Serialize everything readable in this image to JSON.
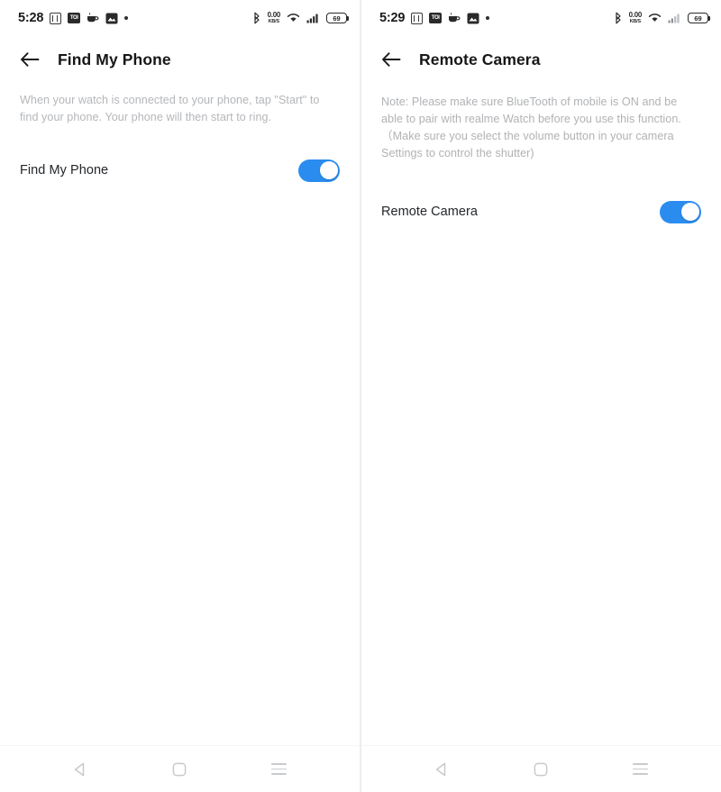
{
  "panels": [
    {
      "id": "find-my-phone",
      "statusbar": {
        "time": "5:28",
        "netspeed_value": "0.00",
        "netspeed_unit": "KB/S",
        "battery_level": "69",
        "icons_left": [
          "calendar-icon",
          "box-icon",
          "coffee-icon",
          "image-icon",
          "dot-icon"
        ],
        "icons_right": [
          "bluetooth-icon",
          "network-speed-icon",
          "wifi-icon",
          "signal-icon",
          "battery-icon"
        ],
        "notif_box_label": "TOI"
      },
      "appbar": {
        "back_label": "back-arrow",
        "title": "Find My Phone"
      },
      "description": "When your watch is connected to your phone, tap \"Start\" to find your phone. Your phone will then start to ring.",
      "setting": {
        "label": "Find My Phone",
        "toggle_on": true,
        "toggle_color": "#2b8cf0"
      },
      "navbar": {
        "back_label": "back",
        "home_label": "home",
        "recents_label": "recents"
      }
    },
    {
      "id": "remote-camera",
      "statusbar": {
        "time": "5:29",
        "netspeed_value": "0.00",
        "netspeed_unit": "KB/S",
        "battery_level": "69",
        "icons_left": [
          "calendar-icon",
          "box-icon",
          "coffee-icon",
          "image-icon",
          "dot-icon"
        ],
        "icons_right": [
          "bluetooth-icon",
          "network-speed-icon",
          "wifi-icon",
          "signal-icon",
          "battery-icon"
        ],
        "notif_box_label": "TOI"
      },
      "appbar": {
        "back_label": "back-arrow",
        "title": "Remote Camera"
      },
      "description": "Note: Please make sure BlueTooth of mobile is ON and be able to pair with realme Watch before you use this function.\n（Make sure you select the volume button in your camera Settings to control the shutter)",
      "setting": {
        "label": "Remote Camera",
        "toggle_on": true,
        "toggle_color": "#2b8cf0"
      },
      "navbar": {
        "back_label": "back",
        "home_label": "home",
        "recents_label": "recents"
      }
    }
  ]
}
